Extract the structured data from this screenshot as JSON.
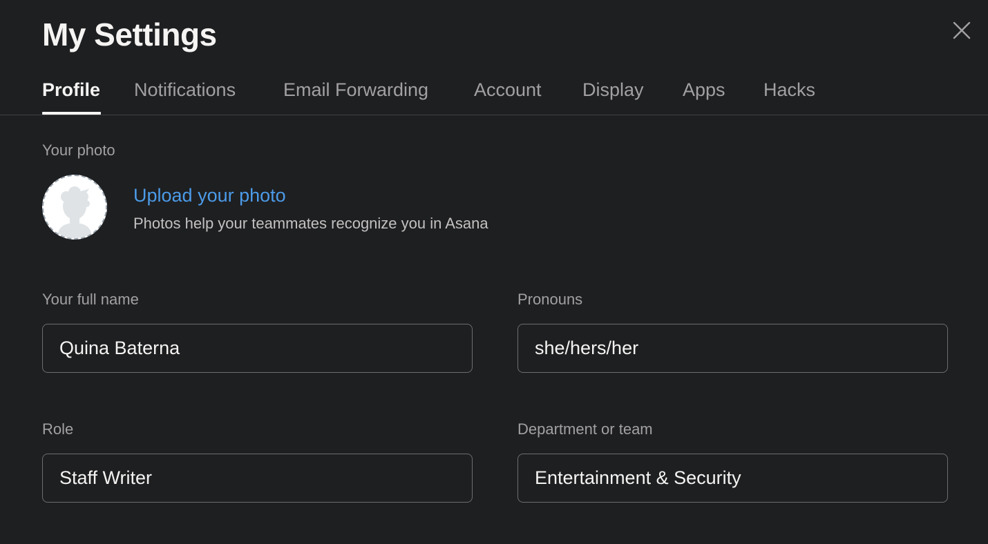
{
  "header": {
    "title": "My Settings",
    "close_icon": "close-icon"
  },
  "tabs": [
    {
      "label": "Profile",
      "active": true
    },
    {
      "label": "Notifications",
      "active": false
    },
    {
      "label": "Email Forwarding",
      "active": false
    },
    {
      "label": "Account",
      "active": false
    },
    {
      "label": "Display",
      "active": false
    },
    {
      "label": "Apps",
      "active": false
    },
    {
      "label": "Hacks",
      "active": false
    }
  ],
  "photo": {
    "section_label": "Your photo",
    "upload_link": "Upload your photo",
    "helper_text": "Photos help your teammates recognize you in Asana",
    "avatar_icon": "default-avatar-icon"
  },
  "form": {
    "full_name": {
      "label": "Your full name",
      "value": "Quina Baterna"
    },
    "pronouns": {
      "label": "Pronouns",
      "value": "she/hers/her"
    },
    "role": {
      "label": "Role",
      "value": "Staff Writer"
    },
    "department": {
      "label": "Department or team",
      "value": "Entertainment & Security"
    }
  },
  "colors": {
    "background": "#1e1f21",
    "link": "#4c9be8",
    "text_primary": "#f5f4f3",
    "text_secondary": "#a2a0a2",
    "field_border": "#6d6e6f"
  }
}
